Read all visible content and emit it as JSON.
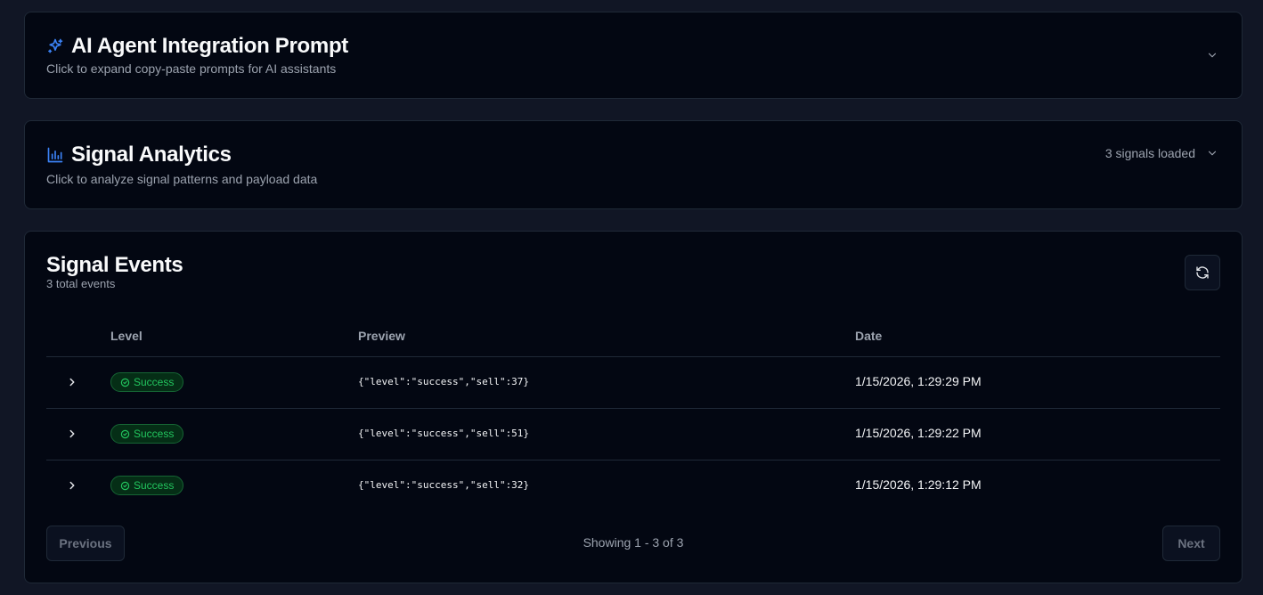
{
  "ai_prompt_card": {
    "title": "AI Agent Integration Prompt",
    "subtitle": "Click to expand copy-paste prompts for AI assistants",
    "icon": "sparkles-icon"
  },
  "analytics_card": {
    "title": "Signal Analytics",
    "subtitle": "Click to analyze signal patterns and payload data",
    "status": "3 signals loaded",
    "icon": "bar-chart-icon"
  },
  "events_card": {
    "title": "Signal Events",
    "count": "3 total events",
    "columns": {
      "level": "Level",
      "preview": "Preview",
      "date": "Date"
    },
    "rows": [
      {
        "level": "Success",
        "preview": "{\"level\":\"success\",\"sell\":37}",
        "date": "1/15/2026, 1:29:29 PM"
      },
      {
        "level": "Success",
        "preview": "{\"level\":\"success\",\"sell\":51}",
        "date": "1/15/2026, 1:29:22 PM"
      },
      {
        "level": "Success",
        "preview": "{\"level\":\"success\",\"sell\":32}",
        "date": "1/15/2026, 1:29:12 PM"
      }
    ],
    "pagination": {
      "previous": "Previous",
      "next": "Next",
      "showing": "Showing 1 - 3 of 3"
    }
  },
  "colors": {
    "background": "#111625",
    "card": "#030712",
    "accent": "#3b82f6",
    "success": "#22c55e"
  }
}
